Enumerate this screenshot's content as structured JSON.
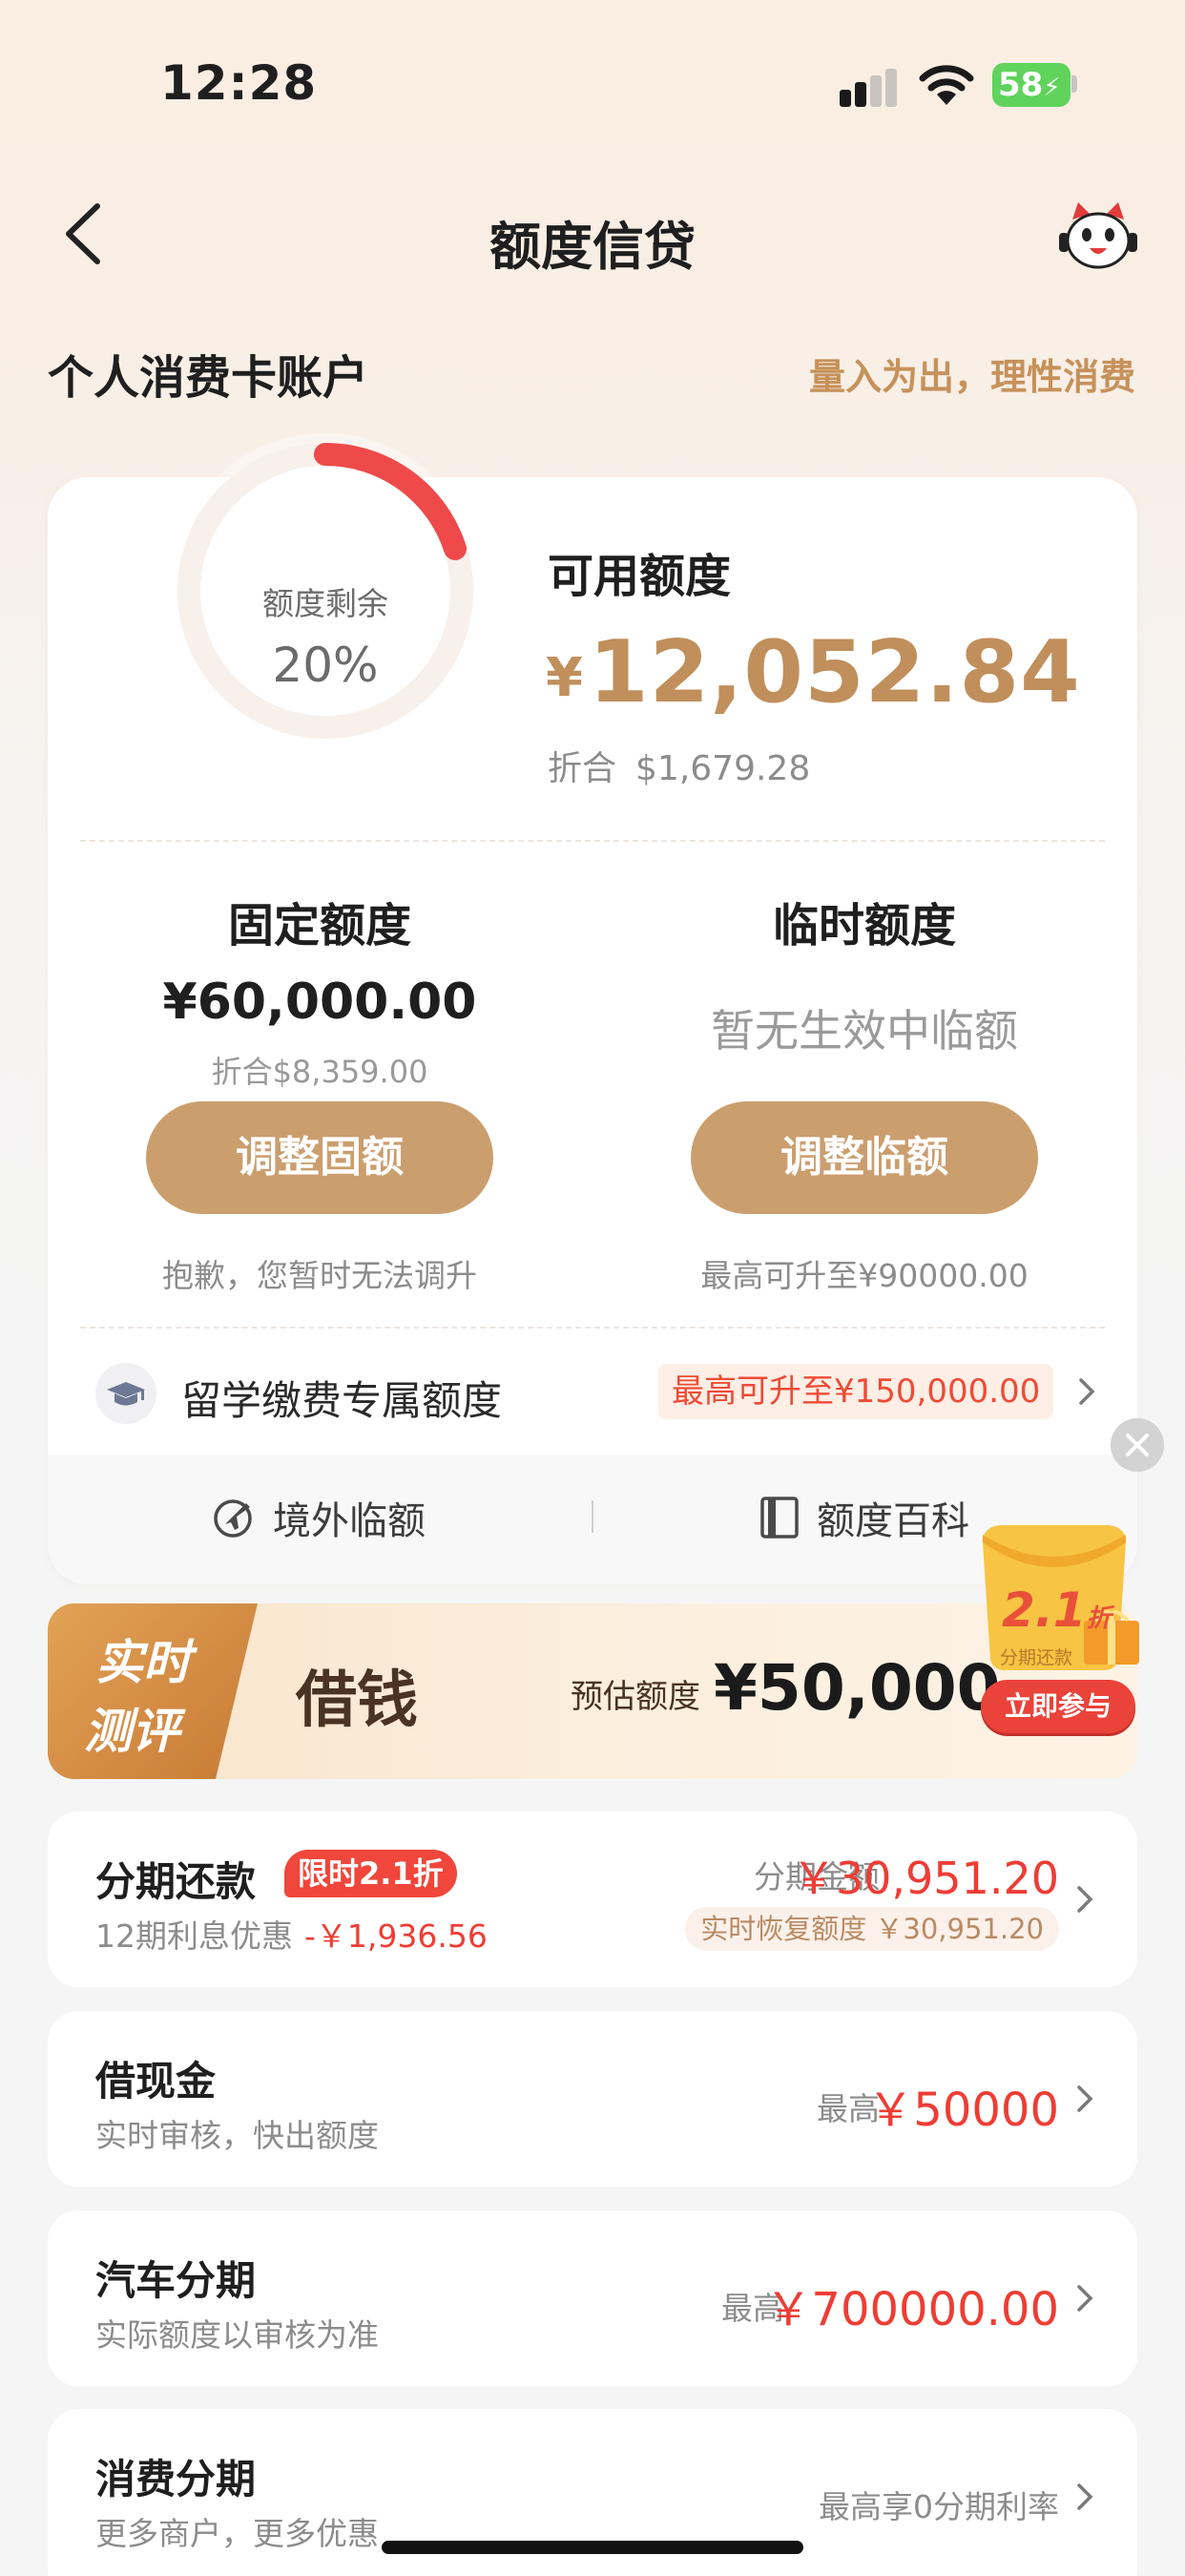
{
  "status_bar": {
    "time": "12:28",
    "battery": "58"
  },
  "nav": {
    "title": "额度信贷"
  },
  "account": {
    "title": "个人消费卡账户",
    "slogan": "量入为出，理性消费"
  },
  "credit": {
    "ring_label": "额度剩余",
    "ring_percent": "20%",
    "remaining_fraction": 0.2,
    "available_label": "可用额度",
    "currency": "¥",
    "available_amount": "12,052.84",
    "converted_label": "折合",
    "converted_amount": "$1,679.28"
  },
  "fixed": {
    "title": "固定额度",
    "amount": "¥60,000.00",
    "converted": "折合$8,359.00",
    "button": "调整固额",
    "note": "抱歉，您暂时无法调升"
  },
  "temporary": {
    "title": "临时额度",
    "status": "暂无生效中临额",
    "button": "调整临额",
    "note": "最高可升至¥90000.00"
  },
  "study": {
    "label": "留学缴费专属额度",
    "badge": "最高可升至¥150,000.00"
  },
  "footer_links": {
    "overseas": "境外临额",
    "wiki": "额度百科"
  },
  "banner": {
    "tag_line1": "实时",
    "tag_line2": "测评",
    "title": "借钱",
    "estimate_label": "预估额度",
    "estimate_amount": "¥50,000.",
    "promo_discount": "2.1",
    "promo_unit": "折",
    "promo_caption": "分期还款",
    "promo_button": "立即参与"
  },
  "list": {
    "installment": {
      "title": "分期还款",
      "tag": "限时2.1折",
      "sub": "12期利息优惠",
      "saving": "-￥1,936.56",
      "amount_label": "分期金额",
      "amount": "￥30,951.20",
      "restore": "实时恢复额度 ￥30,951.20"
    },
    "cash": {
      "title": "借现金",
      "sub": "实时审核，快出额度",
      "label": "最高",
      "amount": "￥50000"
    },
    "car": {
      "title": "汽车分期",
      "sub": "实际额度以审核为准",
      "label": "最高",
      "amount": "￥700000.00"
    },
    "consumer": {
      "title": "消费分期",
      "sub": "更多商户，更多优惠",
      "right": "最高享0分期利率"
    }
  },
  "colors": {
    "accent": "#c08f5c",
    "button": "#cb9e6e",
    "red": "#ee3d34",
    "ring_red": "#ee4a4a"
  }
}
